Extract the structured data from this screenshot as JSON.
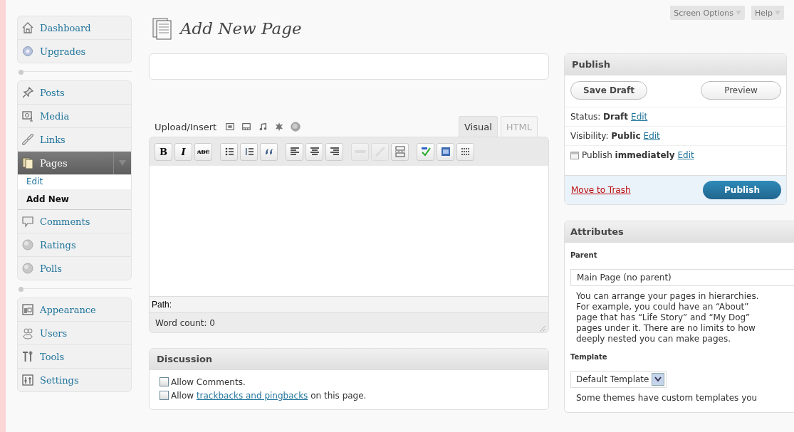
{
  "sidebar": {
    "groups": [
      [
        {
          "label": "Dashboard",
          "selected": false,
          "expanded": false
        },
        {
          "label": "Upgrades",
          "selected": false,
          "expanded": false
        }
      ],
      [
        {
          "label": "Posts",
          "selected": false,
          "expanded": false
        },
        {
          "label": "Media",
          "selected": false,
          "expanded": false
        },
        {
          "label": "Links",
          "selected": false,
          "expanded": false
        },
        {
          "label": "Pages",
          "selected": true,
          "expanded": true,
          "children": [
            {
              "label": "Edit",
              "selected": false
            },
            {
              "label": "Add New",
              "selected": true
            }
          ]
        },
        {
          "label": "Comments",
          "selected": false,
          "expanded": false
        },
        {
          "label": "Ratings",
          "selected": false,
          "expanded": false
        },
        {
          "label": "Polls",
          "selected": false,
          "expanded": false
        }
      ],
      [
        {
          "label": "Appearance",
          "selected": false,
          "expanded": false
        },
        {
          "label": "Users",
          "selected": false,
          "expanded": false
        },
        {
          "label": "Tools",
          "selected": false,
          "expanded": false
        },
        {
          "label": "Settings",
          "selected": false,
          "expanded": false
        }
      ]
    ]
  },
  "header": {
    "screen_options": "Screen Options",
    "help": "Help"
  },
  "page_title": "Add New Page",
  "editor": {
    "upload_label": "Upload/Insert",
    "tabs": [
      {
        "label": "Visual",
        "selected": true
      },
      {
        "label": "HTML",
        "selected": false
      }
    ],
    "toolbar": [
      {
        "kind": "bold",
        "label": "B",
        "disabled": false
      },
      {
        "kind": "italic",
        "label": "I",
        "disabled": false
      },
      {
        "kind": "strike",
        "label": "ABC",
        "disabled": false
      },
      {
        "kind": "bullets",
        "disabled": false
      },
      {
        "kind": "numbers",
        "disabled": false
      },
      {
        "kind": "quote",
        "disabled": false
      },
      {
        "kind": "align-left",
        "disabled": false
      },
      {
        "kind": "align-center",
        "disabled": false
      },
      {
        "kind": "align-right",
        "disabled": false
      },
      {
        "kind": "link",
        "disabled": true
      },
      {
        "kind": "unlink",
        "disabled": true
      },
      {
        "kind": "more",
        "disabled": false
      },
      {
        "kind": "spellcheck",
        "disabled": false
      },
      {
        "kind": "fullscreen",
        "disabled": false
      },
      {
        "kind": "kitchen-sink",
        "disabled": false
      }
    ],
    "path_label": "Path:",
    "word_count": "Word count: 0"
  },
  "discussion": {
    "title": "Discussion",
    "options": [
      {
        "before": "Allow Comments.",
        "checked": false
      },
      {
        "before": "Allow",
        "link": "trackbacks and pingbacks",
        "after": "on this page.",
        "checked": false
      }
    ]
  },
  "publish": {
    "title": "Publish",
    "save_draft": "Save Draft",
    "preview": "Preview",
    "rows": [
      {
        "kind": "text",
        "label": "Status:",
        "value": "Draft",
        "link": "Edit"
      },
      {
        "kind": "text",
        "label": "Visibility:",
        "value": "Public",
        "link": "Edit"
      },
      {
        "kind": "schedule",
        "label": "Publish",
        "value": "immediately",
        "link": "Edit"
      }
    ],
    "trash": "Move to Trash",
    "publish_button": "Publish"
  },
  "attributes": {
    "title": "Attributes",
    "parent_label": "Parent",
    "parent_value": "Main Page (no parent)",
    "parent_help": "You can arrange your pages in hierarchies. For example, you could have an “About” page that has “Life Story” and “My Dog” pages under it. There are no limits to how deeply nested you can make pages.",
    "template_label": "Template",
    "template_value": "Default Template",
    "template_help": "Some themes have custom templates you"
  }
}
